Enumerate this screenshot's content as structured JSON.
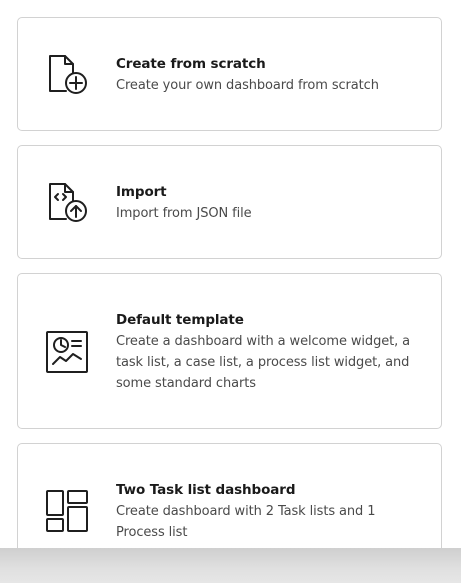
{
  "cards": [
    {
      "title": "Create from scratch",
      "description": "Create your own dashboard from scratch",
      "icon": "file-add-icon"
    },
    {
      "title": "Import",
      "description": "Import from JSON file",
      "icon": "file-upload-icon"
    },
    {
      "title": "Default template",
      "description": "Create a dashboard with a welcome widget, a task list, a case list, a process list widget, and some standard charts",
      "icon": "report-chart-icon"
    },
    {
      "title": "Two Task list dashboard",
      "description": "Create dashboard with 2 Task lists and 1 Process list",
      "icon": "dashboard-layout-icon"
    }
  ],
  "colors": {
    "icon_stroke": "#1f1f1f",
    "card_border": "#d2d2d2",
    "description_text": "#4a4a4a"
  }
}
